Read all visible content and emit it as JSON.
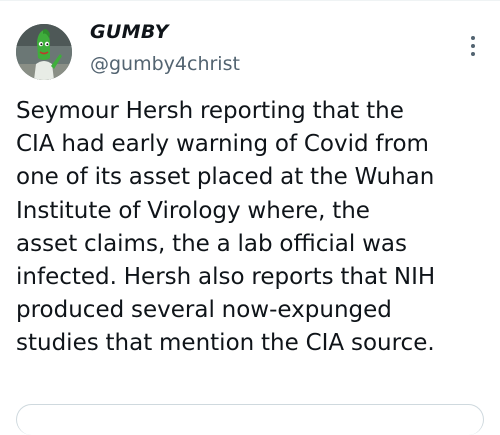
{
  "tweet": {
    "author": {
      "display_name": "GUMBY",
      "handle": "@gumby4christ",
      "avatar_icon": "gumby-avatar"
    },
    "more_icon": "more-options-icon",
    "text_lines": [
      "Seymour Hersh reporting that the",
      "CIA had early warning of Covid from",
      "one of its asset placed at the Wuhan",
      "Institute of Virology where, the",
      "asset claims, the a lab official was",
      "infected. Hersh also reports that NIH",
      "produced several now-expunged",
      "studies that mention the CIA source."
    ]
  },
  "colors": {
    "text_primary": "#0f1419",
    "text_secondary": "#536471",
    "border": "#cfd9de"
  }
}
